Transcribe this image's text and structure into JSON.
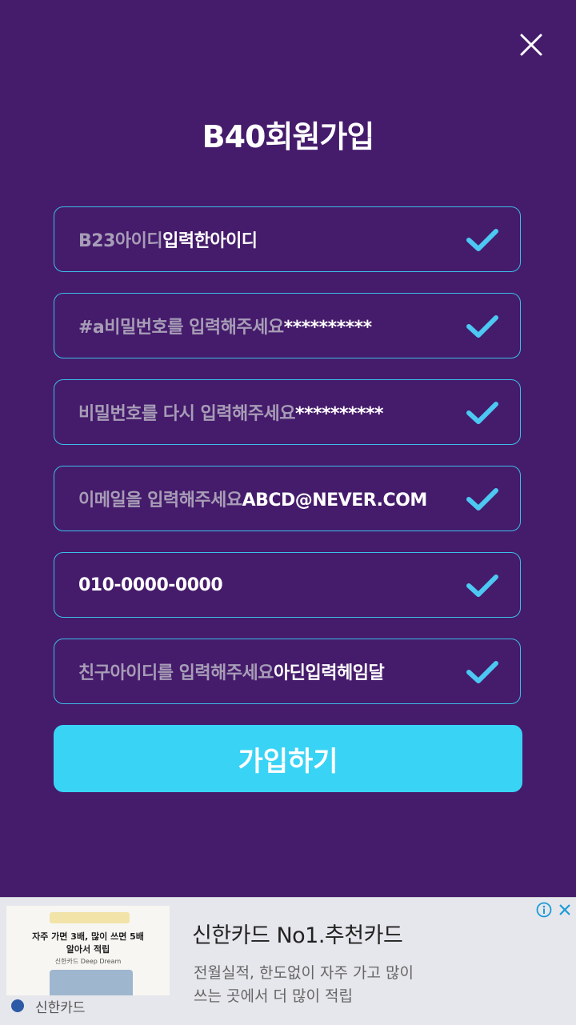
{
  "header": {
    "title": "B40회원가입",
    "close_icon": "close-icon"
  },
  "form": {
    "fields": [
      {
        "hint": "B23아이디",
        "value": "입력한아이디",
        "icon": "check-icon"
      },
      {
        "hint": "#a비밀번호를 입력해주세요",
        "value": "**********",
        "icon": "check-icon"
      },
      {
        "hint": "비밀번호를 다시 입력해주세요",
        "value": "**********",
        "icon": "check-icon"
      },
      {
        "hint": "이메일을 입력해주세요",
        "value": "ABCD@NEVER.COM",
        "icon": "check-icon"
      },
      {
        "hint": "",
        "value": "010-0000-0000",
        "icon": "check-icon"
      },
      {
        "hint": "친구아이디를 입력해주세요",
        "value": "아딘입력헤임달",
        "icon": "check-icon"
      }
    ],
    "submit_label": "가입하기"
  },
  "ad": {
    "headline": "신한카드 No1.추천카드",
    "description_line1": "전월실적, 한도없이 자주 가고 많이",
    "description_line2": "쓰는 곳에서 더 많이 적립",
    "brand": "신한카드",
    "image_line1": "자주 가면 3배, 많이 쓰면 5배",
    "image_line2": "알아서 적립",
    "image_line3": "신한카드 Deep Dream",
    "info_icon": "info-icon",
    "close_icon": "close-icon"
  },
  "colors": {
    "background": "#451b6b",
    "field_border": "#3cbfe8",
    "check": "#4cc8f2",
    "submit": "#39d3f5",
    "hint_text": "#a79db7",
    "value_text": "#ffffff"
  }
}
